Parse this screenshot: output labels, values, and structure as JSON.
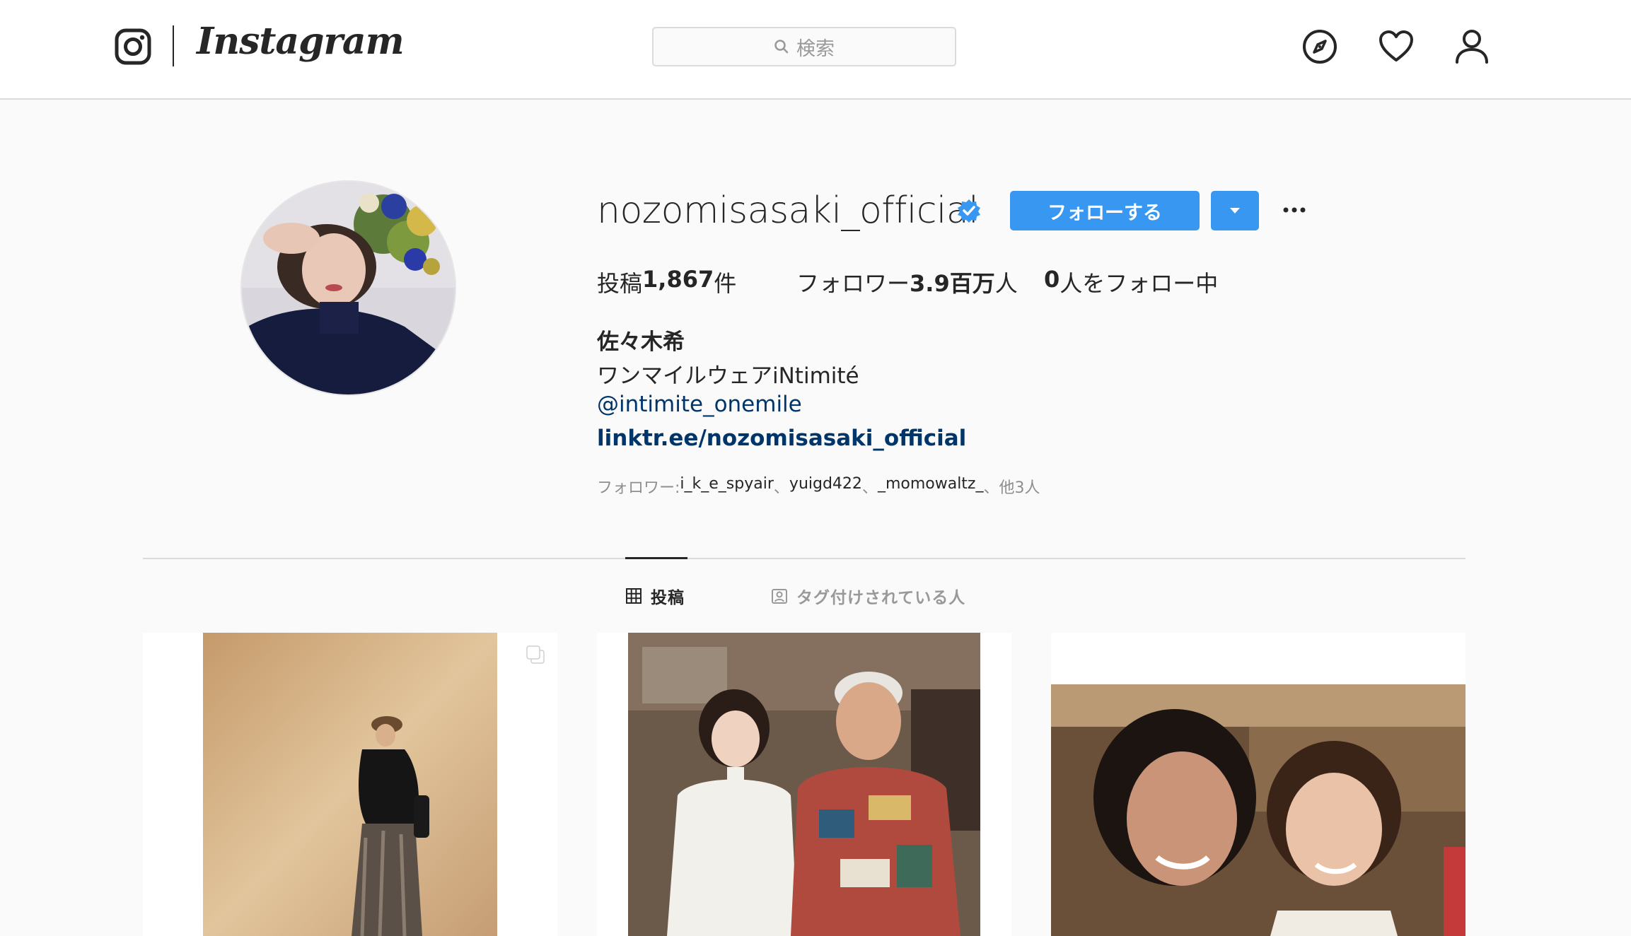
{
  "header": {
    "wordmark": "Instagram",
    "search_placeholder": "検索",
    "icons": [
      "instagram-glyph-icon",
      "search-icon",
      "explore-compass-icon",
      "heart-icon",
      "profile-person-icon"
    ]
  },
  "profile": {
    "username": "nozomisasaki_official",
    "verified": true,
    "follow_label": "フォローする",
    "stats": {
      "posts_prefix": "投稿",
      "posts_value": "1,867",
      "posts_suffix": "件",
      "followers_prefix": "フォロワー",
      "followers_value": "3.9百万",
      "followers_suffix": "人",
      "following_value": "0",
      "following_suffix": "人をフォロー中"
    },
    "full_name": "佐々木希",
    "bio": "ワンマイルウェアiNtimité",
    "mention": "@intimite_onemile",
    "link": "linktr.ee/nozomisasaki_official",
    "followed_by": {
      "prefix": "フォロワー: ",
      "names": [
        "i_k_e_spyair",
        "yuigd422",
        "_momowaltz_"
      ],
      "separator": "、",
      "others": "他3人"
    }
  },
  "tabs": [
    {
      "label": "投稿",
      "active": true
    },
    {
      "label": "タグ付けされている人",
      "active": false
    }
  ],
  "colors": {
    "accent": "#3897f0",
    "link": "#003569",
    "muted": "#8e8e8e",
    "border": "#dbdbdb"
  }
}
